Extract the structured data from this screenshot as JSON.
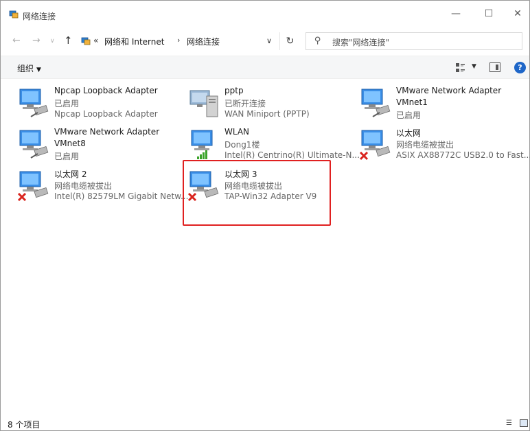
{
  "window": {
    "title": "网络连接",
    "controls": {
      "minimize": "—",
      "maximize": "☐",
      "close": "✕"
    }
  },
  "address": {
    "back": "←",
    "forward": "→",
    "history": "∨",
    "up": "↑",
    "separator": "«",
    "crumb1": "网络和 Internet",
    "crumb_arrow": "›",
    "crumb2": "网络连接",
    "dropdown": "∨",
    "refresh": "↻",
    "search_icon": "⚲",
    "search_placeholder": "搜索\"网络连接\""
  },
  "toolbar": {
    "organize": "组织",
    "organize_caret": "▼",
    "view_caret": "▼",
    "help": "?"
  },
  "items": [
    {
      "name": "Npcap Loopback Adapter",
      "line2": "已启用",
      "line3": "Npcap Loopback Adapter",
      "state": "enabled"
    },
    {
      "name": "pptp",
      "line2": "已断开连接",
      "line3": "WAN Miniport (PPTP)",
      "state": "disconnected"
    },
    {
      "name": "VMware Network Adapter",
      "line2": "VMnet1",
      "line3": "已启用",
      "state": "enabled"
    },
    {
      "name": "VMware Network Adapter",
      "line2": "VMnet8",
      "line3": "已启用",
      "state": "enabled"
    },
    {
      "name": "WLAN",
      "line2": "Dong1楼",
      "line3": "Intel(R) Centrino(R) Ultimate-N...",
      "state": "wifi"
    },
    {
      "name": "以太网",
      "line2": "网络电缆被拔出",
      "line3": "ASIX AX88772C USB2.0 to Fast...",
      "state": "unplugged"
    },
    {
      "name": "以太网 2",
      "line2": "网络电缆被拔出",
      "line3": "Intel(R) 82579LM Gigabit Netw...",
      "state": "unplugged"
    },
    {
      "name": "以太网 3",
      "line2": "网络电缆被拔出",
      "line3": "TAP-Win32 Adapter V9",
      "state": "unplugged"
    }
  ],
  "status": {
    "count": "8 个项目"
  },
  "colors": {
    "accent": "#1e66c8",
    "highlight": "#e02020",
    "error": "#d9231d",
    "wifi": "#3aa32a"
  }
}
